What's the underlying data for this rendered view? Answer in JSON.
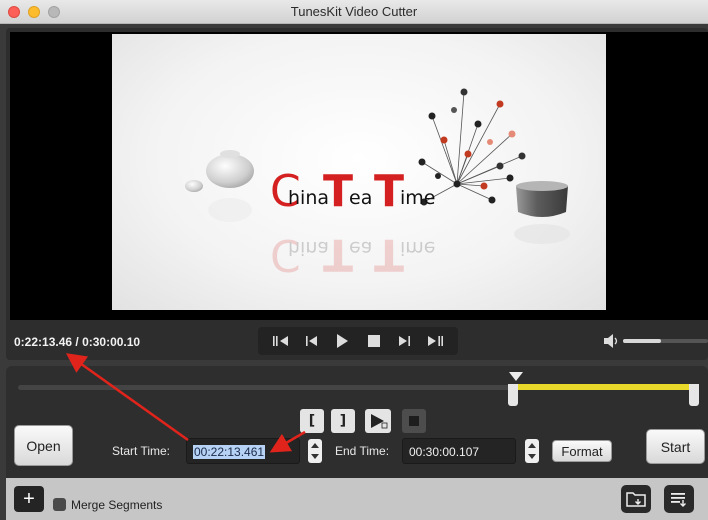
{
  "window": {
    "title": "TunesKit Video Cutter"
  },
  "preview": {
    "logo": {
      "c": "C",
      "hina": "hina",
      "t1": "T",
      "ea": "ea",
      "t2": "T",
      "ime": "ime"
    },
    "current_time": "0:22:13.46",
    "separator": " / ",
    "total_time": "0:30:00.10"
  },
  "volume": {
    "level": 0.45
  },
  "timeline": {
    "selection_start": 0.741,
    "selection_end": 1.0
  },
  "controls": {
    "open_label": "Open",
    "start_time_label": "Start Time:",
    "start_time_value": "00:22:13.461",
    "end_time_label": "End Time:",
    "end_time_value": "00:30:00.107",
    "format_label": "Format",
    "start_label": "Start",
    "mark_start": "[",
    "mark_end": "]"
  },
  "bottom": {
    "plus_label": "+",
    "merge_label": "Merge Segments"
  },
  "colors": {
    "accent_red": "#e0241b",
    "selection_yellow": "#e8d82a",
    "text_selection": "#b6d2f5"
  }
}
